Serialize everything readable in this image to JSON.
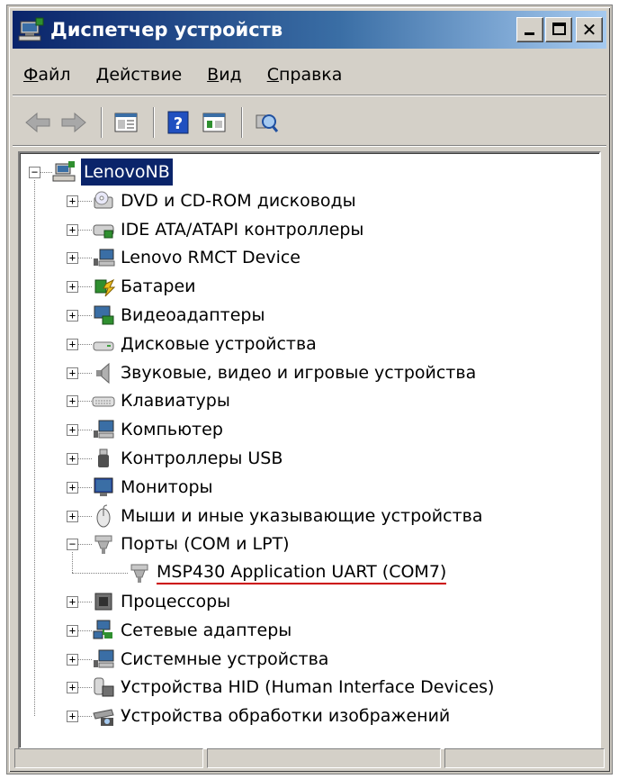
{
  "window": {
    "title": "Диспетчер устройств",
    "icon": "device-manager-icon",
    "buttons": [
      "minimize",
      "maximize",
      "close"
    ],
    "close_glyph": "✕"
  },
  "menu": {
    "items": [
      {
        "label": "Файл",
        "accel": "Ф",
        "rest": "айл"
      },
      {
        "label": "Действие",
        "accel": "Д",
        "rest": "ействие"
      },
      {
        "label": "Вид",
        "accel": "В",
        "rest": "ид"
      },
      {
        "label": "Справка",
        "accel": "С",
        "rest": "правка"
      }
    ]
  },
  "toolbar": {
    "tools": [
      "back-arrow-icon",
      "forward-arrow-icon",
      "properties-icon",
      "help-icon",
      "update-driver-icon",
      "scan-hardware-icon"
    ]
  },
  "tree": {
    "root": {
      "label": "LenovoNB",
      "icon": "computer-network-icon",
      "expanded": true
    },
    "categories": [
      {
        "label": "DVD и CD-ROM дисководы",
        "icon": "dvd-drive-icon",
        "expanded": false
      },
      {
        "label": "IDE ATA/ATAPI контроллеры",
        "icon": "ide-controller-icon",
        "expanded": false
      },
      {
        "label": "Lenovo RMCT Device",
        "icon": "rmct-device-icon",
        "expanded": false
      },
      {
        "label": "Батареи",
        "icon": "battery-icon",
        "expanded": false
      },
      {
        "label": "Видеоадаптеры",
        "icon": "display-adapter-icon",
        "expanded": false
      },
      {
        "label": "Дисковые устройства",
        "icon": "disk-drive-icon",
        "expanded": false
      },
      {
        "label": "Звуковые, видео и игровые устройства",
        "icon": "speaker-icon",
        "expanded": false
      },
      {
        "label": "Клавиатуры",
        "icon": "keyboard-icon",
        "expanded": false
      },
      {
        "label": "Компьютер",
        "icon": "computer-icon",
        "expanded": false
      },
      {
        "label": "Контроллеры USB",
        "icon": "usb-icon",
        "expanded": false
      },
      {
        "label": "Мониторы",
        "icon": "monitor-icon",
        "expanded": false
      },
      {
        "label": "Мыши и иные указывающие устройства",
        "icon": "mouse-icon",
        "expanded": false
      },
      {
        "label": "Порты (COM и LPT)",
        "icon": "port-icon",
        "expanded": true,
        "children": [
          {
            "label": "MSP430 Application UART (COM7)",
            "icon": "port-icon",
            "highlighted": true
          }
        ]
      },
      {
        "label": "Процессоры",
        "icon": "processor-icon",
        "expanded": false
      },
      {
        "label": "Сетевые адаптеры",
        "icon": "network-adapter-icon",
        "expanded": false
      },
      {
        "label": "Системные устройства",
        "icon": "system-devices-icon",
        "expanded": false
      },
      {
        "label": "Устройства HID (Human Interface Devices)",
        "icon": "hid-icon",
        "expanded": false
      },
      {
        "label": "Устройства обработки изображений",
        "icon": "imaging-device-icon",
        "expanded": false
      }
    ]
  },
  "colors": {
    "titlebar_start": "#0a246a",
    "titlebar_end": "#a6caf0",
    "selection": "#0a246a",
    "highlight_underline": "#cc0000",
    "face": "#d4d0c8"
  }
}
